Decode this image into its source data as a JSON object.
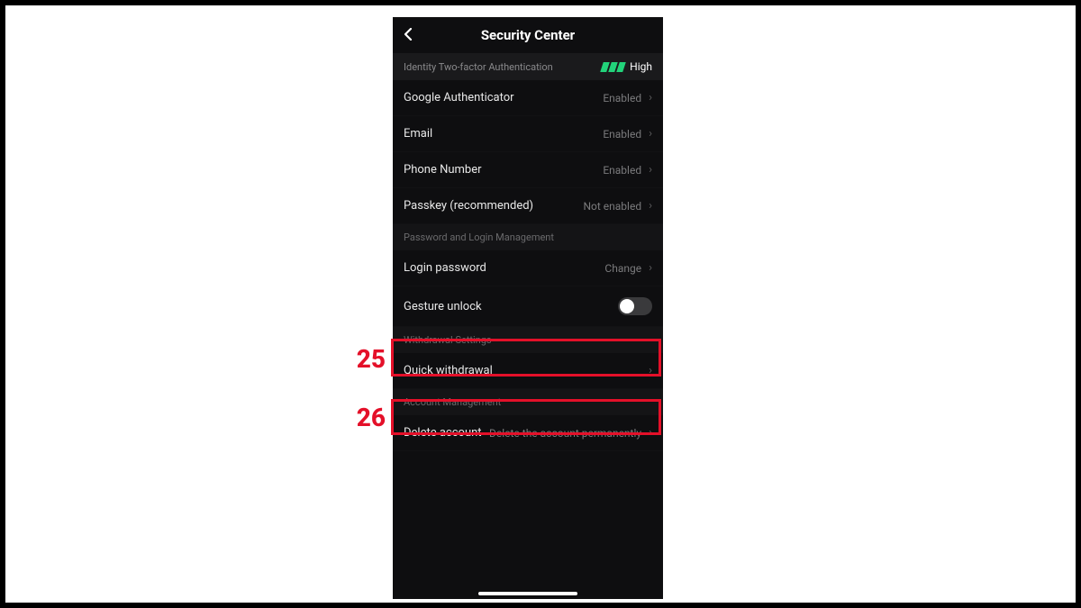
{
  "header": {
    "title": "Security Center"
  },
  "banner": {
    "label": "Identity Two-factor Authentication",
    "level": "High"
  },
  "auth": {
    "google": {
      "label": "Google Authenticator",
      "status": "Enabled"
    },
    "email": {
      "label": "Email",
      "status": "Enabled"
    },
    "phone": {
      "label": "Phone Number",
      "status": "Enabled"
    },
    "passkey": {
      "label": "Passkey (recommended)",
      "status": "Not enabled"
    }
  },
  "sections": {
    "pwdHead": "Password and Login Management",
    "loginPwd": {
      "label": "Login password",
      "status": "Change"
    },
    "gesture": {
      "label": "Gesture unlock"
    },
    "withdrawHead": "Withdrawal Settings",
    "quick": {
      "label": "Quick withdrawal"
    },
    "acctHead": "Account Management",
    "delete": {
      "label": "Delete account",
      "status": "Delete the account permanently"
    }
  },
  "callouts": {
    "a": "25",
    "b": "26"
  }
}
